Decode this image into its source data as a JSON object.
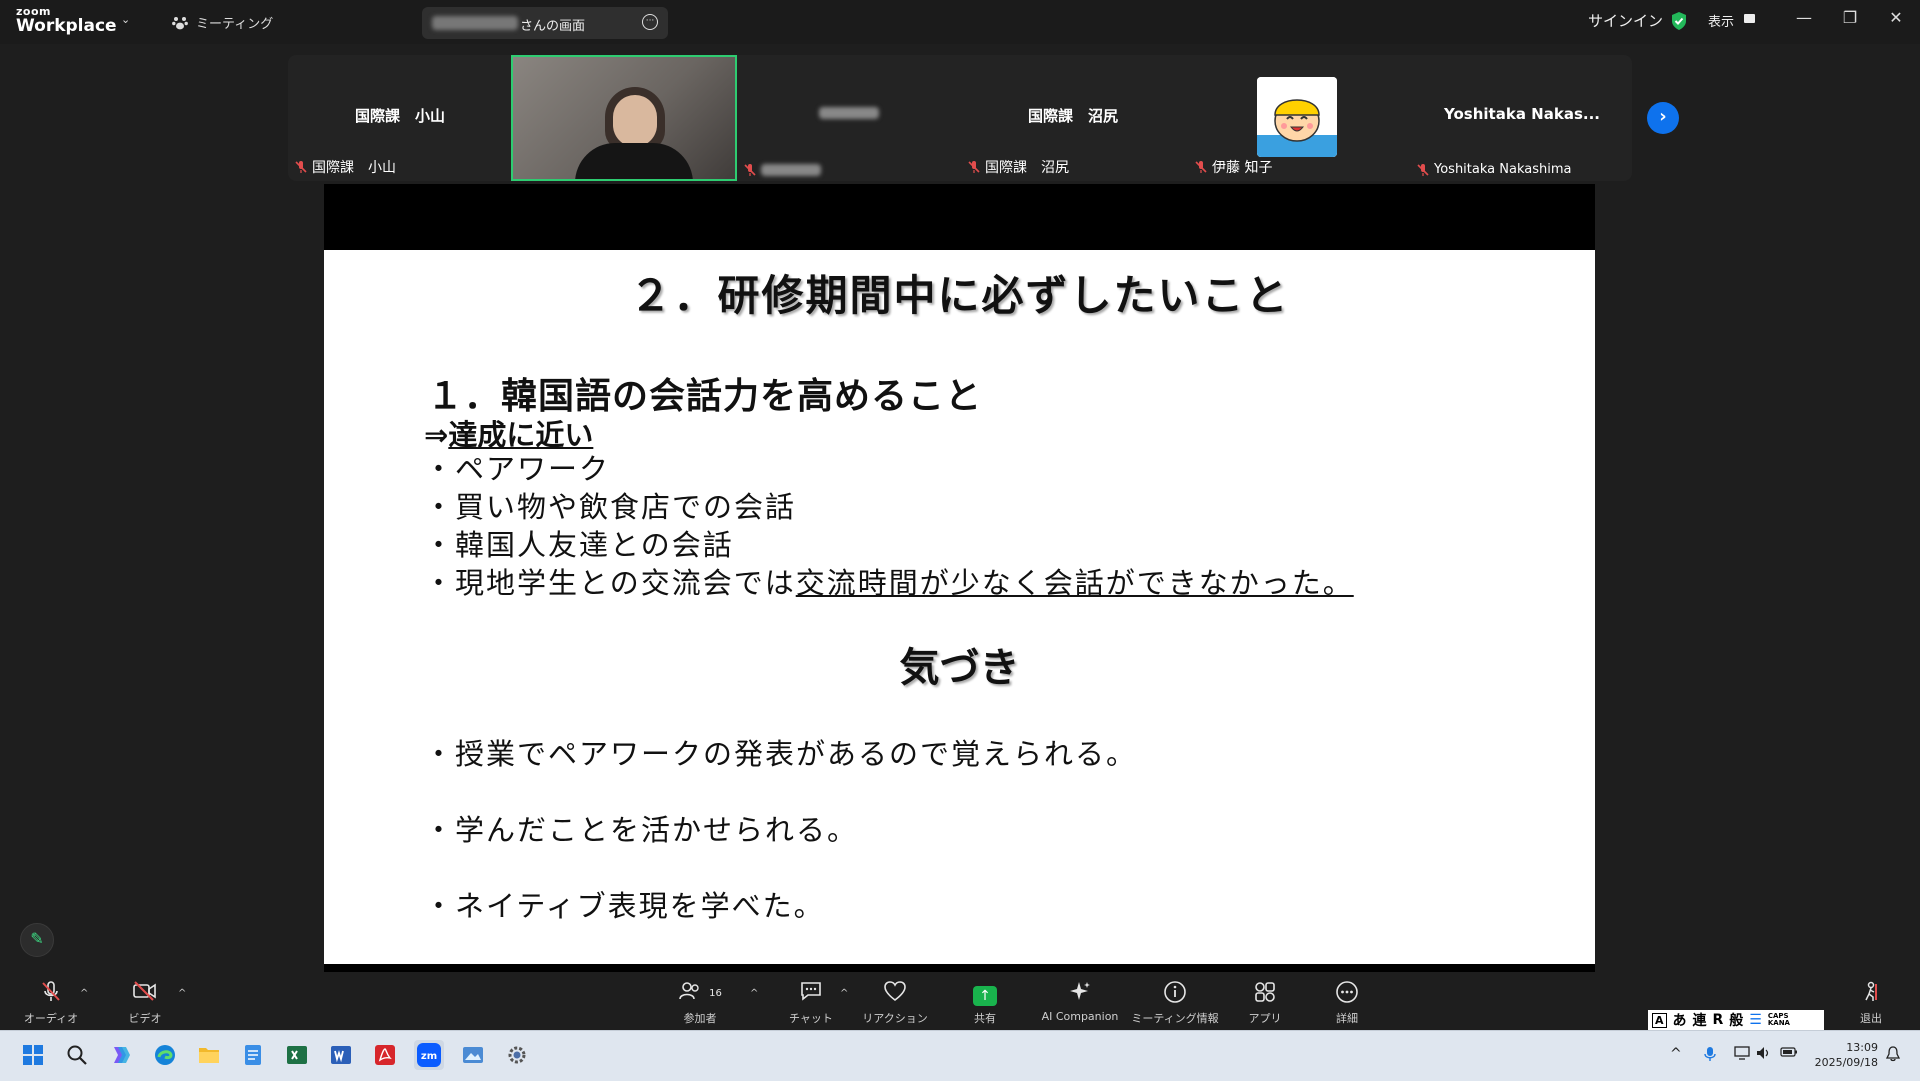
{
  "app": {
    "logo_line1": "zoom",
    "logo_line2": "Workplace",
    "meeting_tab": "ミーティング",
    "screen_tab_label": "さんの画面",
    "signin": "サインイン",
    "view": "表示"
  },
  "participants": [
    {
      "center_name": "国際課　小山",
      "footer": "国際課　小山",
      "muted": true,
      "type": "name"
    },
    {
      "center_name": "",
      "footer": "",
      "muted": true,
      "type": "video",
      "active_speaker": true
    },
    {
      "center_name": "",
      "footer": "",
      "muted": true,
      "type": "name-hidden"
    },
    {
      "center_name": "国際課　沼尻",
      "footer": "国際課　沼尻",
      "muted": true,
      "type": "name"
    },
    {
      "center_name": "",
      "footer": "伊藤 知子",
      "muted": true,
      "type": "avatar"
    },
    {
      "center_name": "Yoshitaka  Nakas...",
      "footer": "Yoshitaka Nakashima",
      "muted": true,
      "type": "name"
    }
  ],
  "slide": {
    "title": "２．研修期間中に必ずしたいこと",
    "heading": "１．韓国語の会話力を高めること",
    "arrow_prefix": "⇒",
    "arrow_text": "達成に近い",
    "bullets": [
      "・ペアワーク",
      "・買い物や飲食店での会話",
      "・韓国人友達との会話"
    ],
    "bullet4_plain": "・現地学生との交流会では",
    "bullet4_underlined": "交流時間が少なく会話ができなかった。",
    "kizuki": "気づき",
    "insights": [
      "・授業でペアワークの発表があるので覚えられる。",
      "・学んだことを活かせられる。",
      "・ネイティブ表現を学べた。"
    ]
  },
  "toolbar": {
    "audio": "オーディオ",
    "video": "ビデオ",
    "participants": "参加者",
    "participants_count": "16",
    "chat": "チャット",
    "reactions": "リアクション",
    "share": "共有",
    "ai_companion": "AI Companion",
    "meeting_info": "ミーティング情報",
    "apps": "アプリ",
    "more": "詳細",
    "leave": "退出"
  },
  "ime": {
    "mode1": "あ",
    "mode2": "連",
    "mode3": "R",
    "mode4": "般",
    "caps1": "CAPS",
    "caps2": "KANA"
  },
  "taskbar": {
    "time": "13:09",
    "date": "2025/09/18"
  },
  "colors": {
    "active_speaker_border": "#2ecc71",
    "accent_blue": "#0e72ed",
    "share_green": "#19b34d",
    "muted_red": "#e24d4d"
  }
}
